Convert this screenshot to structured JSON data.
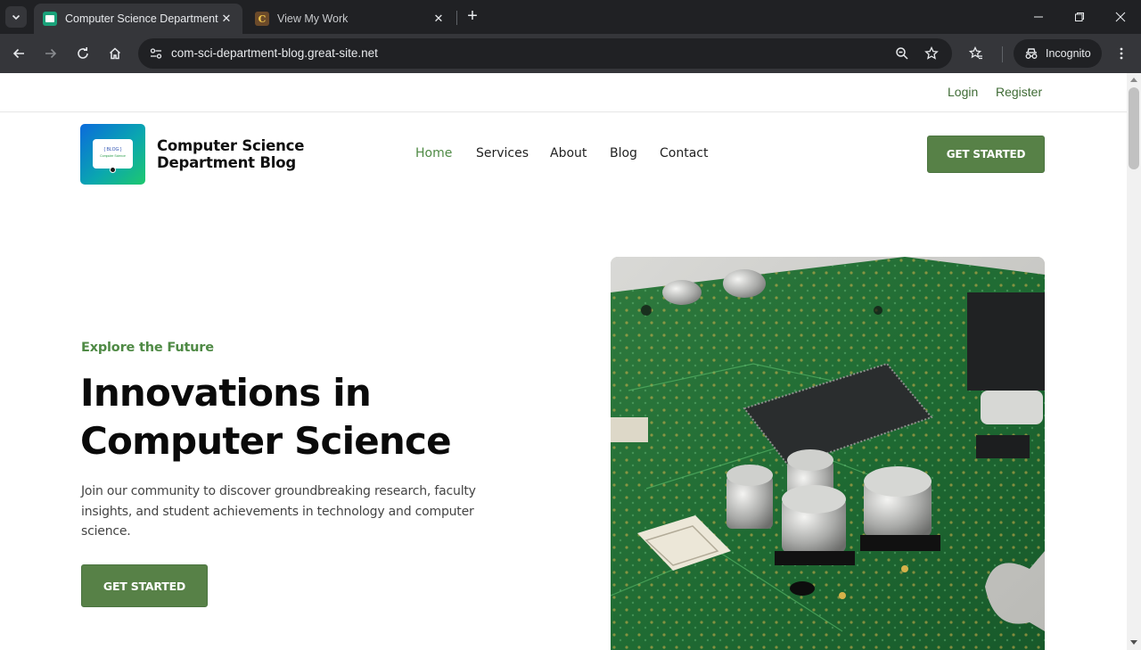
{
  "browser": {
    "tabs": [
      {
        "title": "Computer Science Department",
        "active": true
      },
      {
        "title": "View My Work",
        "active": false
      }
    ],
    "url": "com-sci-department-blog.great-site.net",
    "incognito_label": "Incognito"
  },
  "page": {
    "topbar": {
      "login": "Login",
      "register": "Register"
    },
    "brand": {
      "name": "Computer Science Department Blog",
      "logo_line1": "{ BLOG }",
      "logo_line2": "Computer Science"
    },
    "nav": [
      {
        "label": "Home",
        "active": true
      },
      {
        "label": "Services",
        "active": false
      },
      {
        "label": "About",
        "active": false
      },
      {
        "label": "Blog",
        "active": false
      },
      {
        "label": "Contact",
        "active": false
      }
    ],
    "header_cta": "GET STARTED",
    "hero": {
      "eyebrow": "Explore the Future",
      "headline": "Innovations in Computer Science",
      "lead": "Join our community to discover groundbreaking research, faculty insights, and student achievements in technology and computer science.",
      "cta": "GET STARTED"
    },
    "colors": {
      "accent": "#578147",
      "accent_text": "#4f8a45"
    }
  }
}
